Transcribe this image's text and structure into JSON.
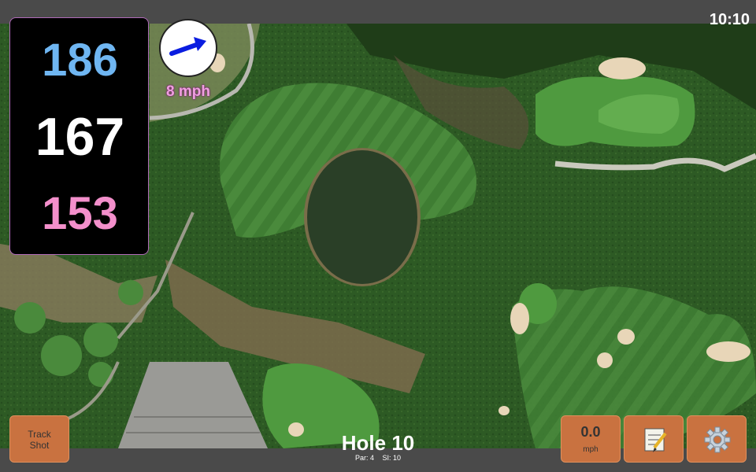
{
  "status": {
    "time": "10:10"
  },
  "distances": {
    "back": "186",
    "center": "167",
    "front": "153"
  },
  "wind": {
    "speed": "8 mph",
    "icon": "wind-arrow-icon"
  },
  "hole": {
    "title": "Hole 10",
    "par": "Par: 4",
    "stroke_index": "SI: 10"
  },
  "buttons": {
    "track_shot": {
      "line1": "Track",
      "line2": "Shot"
    },
    "speed": {
      "value": "0.0",
      "unit": "mph"
    },
    "notes": {
      "icon": "notepad-icon"
    },
    "settings": {
      "icon": "gear-icon"
    }
  },
  "colors": {
    "back": "#6fb6f2",
    "center": "#ffffff",
    "front": "#f38fcb",
    "button": "#c97240",
    "wind_arrow": "#0a1de0"
  }
}
